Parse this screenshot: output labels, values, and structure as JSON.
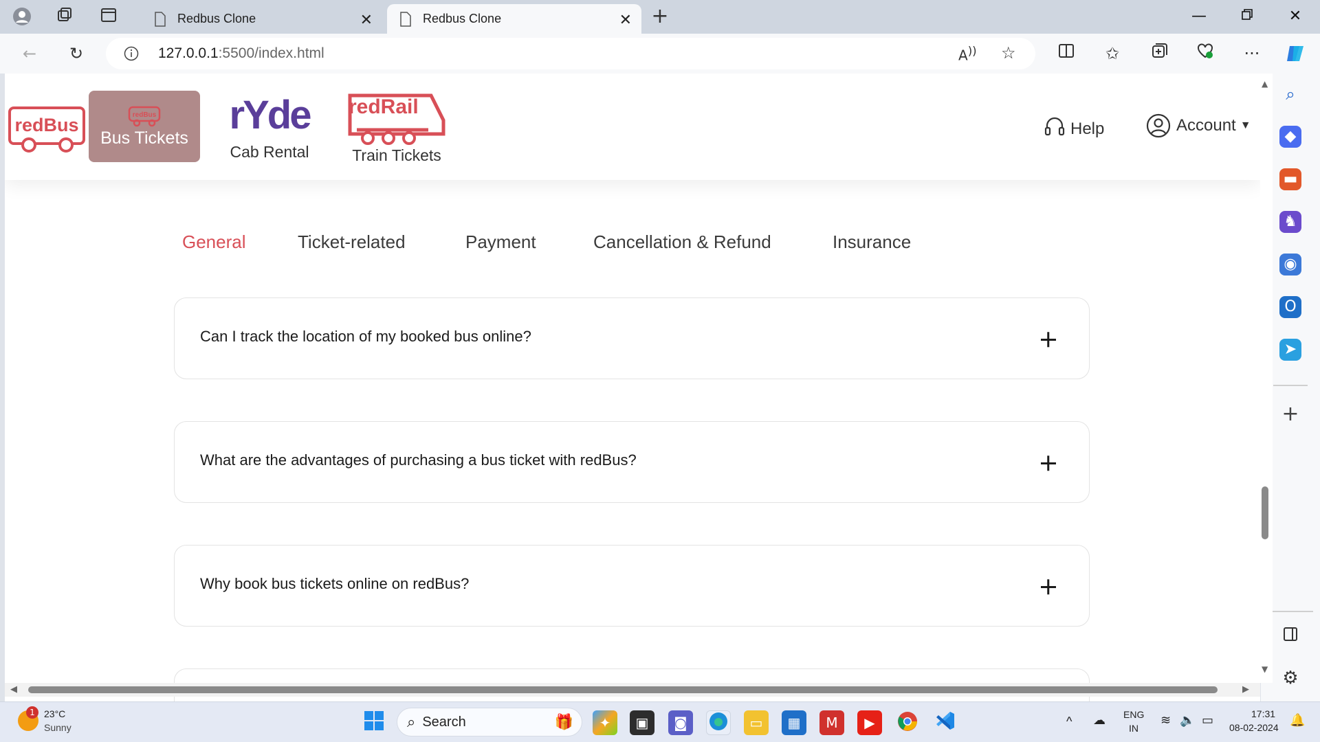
{
  "browser": {
    "tabs": [
      {
        "title": "Redbus Clone"
      },
      {
        "title": "Redbus Clone"
      }
    ],
    "url_host": "127.0.0.1",
    "url_path": ":5500/index.html"
  },
  "header": {
    "logo_text": "redBus",
    "nav": [
      {
        "label": "Bus Tickets"
      },
      {
        "label": "Cab Rental",
        "brand": "rYde"
      },
      {
        "label": "Train Tickets",
        "brand": "redRail"
      }
    ],
    "help_label": "Help",
    "account_label": "Account"
  },
  "faq": {
    "tabs": [
      {
        "label": "General",
        "active": true
      },
      {
        "label": "Ticket-related"
      },
      {
        "label": "Payment"
      },
      {
        "label": "Cancellation & Refund"
      },
      {
        "label": "Insurance"
      }
    ],
    "questions": [
      "Can I track the location of my booked bus online?",
      "What are the advantages of purchasing a bus ticket with redBus?",
      "Why book bus tickets online on redBus?"
    ]
  },
  "taskbar": {
    "weather_temp": "23°C",
    "weather_desc": "Sunny",
    "weather_badge": "1",
    "search_label": "Search",
    "lang_1": "ENG",
    "lang_2": "IN",
    "time": "17:31",
    "date": "08-02-2024"
  },
  "colors": {
    "brand_red": "#d84f57",
    "bus_tile": "#b08a8a",
    "ryde_purple": "#5a3e9a"
  }
}
